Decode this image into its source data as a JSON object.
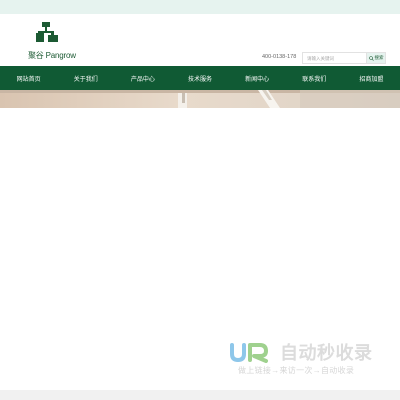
{
  "brand": {
    "logo_text": "聚谷 Pangrow"
  },
  "header": {
    "phone": "400-0138-178",
    "search": {
      "placeholder": "请输入关键词",
      "button_label": "搜索"
    }
  },
  "nav": {
    "items": [
      {
        "label": "网站首页"
      },
      {
        "label": "关于我们"
      },
      {
        "label": "产品中心"
      },
      {
        "label": "技术服务"
      },
      {
        "label": "新闻中心"
      },
      {
        "label": "联系我们"
      },
      {
        "label": "招商加盟"
      }
    ]
  },
  "watermark": {
    "title": "自动秒收录",
    "subtitle": "做上链接→来访一次→自动收录",
    "logo_text": "JR"
  },
  "colors": {
    "brand_green": "#105a34",
    "top_strip": "#e6f3ef",
    "banner_wall": "#e6d7c8",
    "watermark_gray": "#dcdcdc"
  },
  "icons": {
    "search_button": "search-icon",
    "logo": "building-blocks-logo-icon"
  }
}
